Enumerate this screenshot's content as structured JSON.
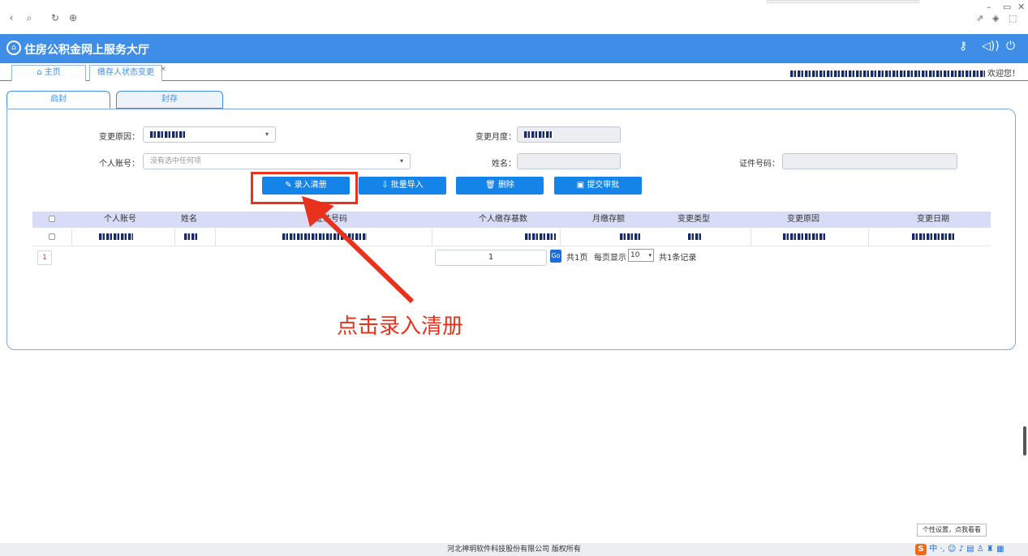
{
  "browser": {
    "back_icon": "‹",
    "link_icon": "⌕",
    "refresh_icon": "↻",
    "globe_icon": "⊕",
    "minimize": "–",
    "restore": "▭",
    "close": "✕"
  },
  "header": {
    "title": "住房公积金网上服务大厅",
    "bg_color": "#3e8ee8"
  },
  "tabs": {
    "home_label": "主页",
    "active_label": "缴存人状态变更",
    "welcome": "欢迎您！"
  },
  "subtabs": [
    "启封",
    "封存"
  ],
  "form": {
    "change_reason_label": "变更原因：",
    "change_month_label": "变更月度：",
    "account_label": "个人账号：",
    "account_placeholder": "没有选中任何项",
    "name_label": "姓名：",
    "id_label": "证件号码："
  },
  "buttons": {
    "enter_list": "录入清册",
    "batch_import": "批量导入",
    "delete": "删除",
    "submit": "提交审批"
  },
  "table": {
    "columns": [
      "个人账号",
      "姓名",
      "证件号码",
      "个人缴存基数",
      "月缴存额",
      "变更类型",
      "变更原因",
      "变更日期"
    ]
  },
  "pager": {
    "current_page": "1",
    "page_input": "1",
    "go": "Go",
    "total_pages": "共1页",
    "per_page_label": "每页显示",
    "per_page": "10",
    "total_records": "共1条记录"
  },
  "annotation": {
    "callout": "点击录入清册",
    "color": "#e8321e"
  },
  "footer": {
    "copyright": "河北神玥软件科技股份有限公司 版权所有"
  },
  "ime": {
    "tooltip": "个性设置，点我看看",
    "lang": "中"
  }
}
